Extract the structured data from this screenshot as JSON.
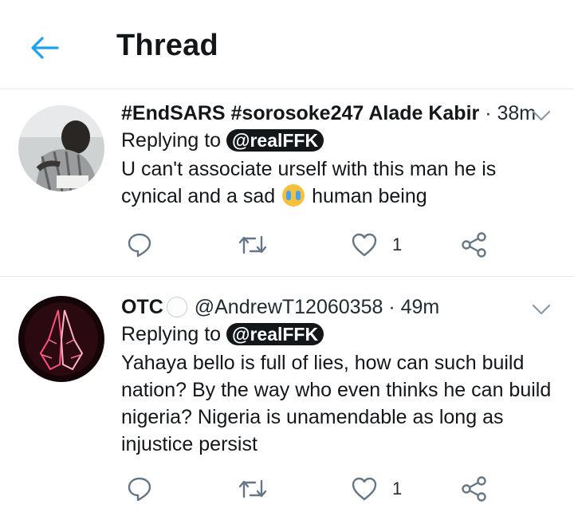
{
  "header": {
    "title": "Thread"
  },
  "tweets": [
    {
      "name": "#EndSARS #sorosoke247 Alade Kabir",
      "handle": "",
      "time": "38m",
      "replying_prefix": "Replying to",
      "replying_to": "@realFFK",
      "text_before_emoji": "U can't associate urself with this man he is cynical and a sad ",
      "emoji": "crying-face",
      "text_after_emoji": " human being",
      "like_count": "1"
    },
    {
      "name": "OTC",
      "handle": "@AndrewT12060358",
      "time": "49m",
      "replying_prefix": "Replying to",
      "replying_to": "@realFFK",
      "text": "Yahaya bello is full of lies, how can such build nation? By the way who even thinks he can build nigeria? Nigeria is unamendable as long as injustice persist",
      "like_count": "1"
    }
  ],
  "colors": {
    "accent": "#1da1f2",
    "icon": "#657786",
    "divider": "#e1e8ed",
    "text": "#14171a"
  }
}
